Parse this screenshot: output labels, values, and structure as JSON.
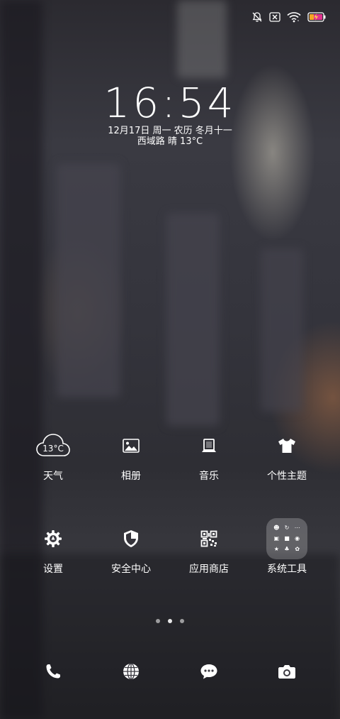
{
  "status_bar": {
    "icons": [
      "bell-muted-icon",
      "no-sim-icon",
      "wifi-icon",
      "battery-charging-icon"
    ]
  },
  "lockclock": {
    "time": "16:54",
    "date": "12月17日 周一 农历 冬月十一",
    "weather": "西域路 晴 13°C"
  },
  "apps": [
    {
      "label": "天气",
      "icon": "weather-cloud-icon",
      "badge": "13°C"
    },
    {
      "label": "相册",
      "icon": "gallery-icon"
    },
    {
      "label": "音乐",
      "icon": "music-icon"
    },
    {
      "label": "个性主题",
      "icon": "theme-shirt-icon"
    },
    {
      "label": "设置",
      "icon": "settings-gear-icon"
    },
    {
      "label": "安全中心",
      "icon": "security-shield-icon"
    },
    {
      "label": "应用商店",
      "icon": "app-store-qr-icon"
    },
    {
      "label": "系统工具",
      "icon": "system-tools-folder-icon"
    }
  ],
  "page_indicator": {
    "count": 3,
    "active": 1
  },
  "dock": [
    {
      "icon": "phone-icon"
    },
    {
      "icon": "browser-globe-icon"
    },
    {
      "icon": "messages-icon"
    },
    {
      "icon": "camera-icon"
    }
  ]
}
